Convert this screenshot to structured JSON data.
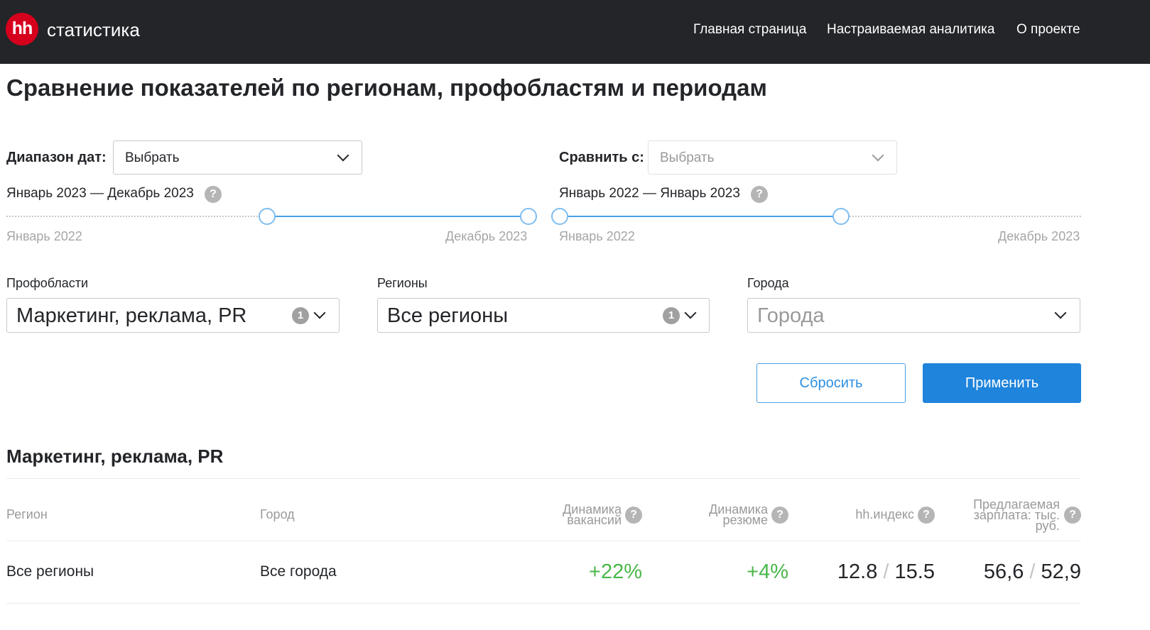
{
  "header": {
    "logo_mark": "hh",
    "logo_text": "статистика",
    "nav": [
      "Главная страница",
      "Настраиваемая аналитика",
      "О проекте"
    ]
  },
  "page_title": "Сравнение показателей по регионам, профобластям и периодам",
  "date_range": {
    "label": "Диапазон дат:",
    "select_value": "Выбрать",
    "range_text": "Январь 2023 — Декабрь 2023",
    "help": "?",
    "slider_min_label": "Январь 2022",
    "slider_max_label": "Декабрь 2023",
    "selected_from": "Январь 2023",
    "selected_to": "Декабрь 2023"
  },
  "compare": {
    "label": "Сравнить с:",
    "select_value": "Выбрать",
    "range_text": "Январь 2022 — Январь 2023",
    "help": "?",
    "slider_min_label": "Январь 2022",
    "slider_max_label": "Декабрь 2023",
    "selected_from": "Январь 2022",
    "selected_to": "Январь 2023"
  },
  "filters": {
    "profareas": {
      "label": "Профобласти",
      "value": "Маркетинг, реклама, PR",
      "count": "1"
    },
    "regions": {
      "label": "Регионы",
      "value": "Все регионы",
      "count": "1"
    },
    "cities": {
      "label": "Города",
      "placeholder": "Города"
    }
  },
  "buttons": {
    "reset": "Сбросить",
    "apply": "Применить"
  },
  "results": {
    "title": "Маркетинг, реклама, PR",
    "columns": {
      "region": "Регион",
      "city": "Город",
      "vacancy_dynamics": [
        "Динамика",
        "вакансий"
      ],
      "resume_dynamics": [
        "Динамика",
        "резюме"
      ],
      "hh_index": "hh.индекс",
      "salary": [
        "Предлагаемая",
        "зарплата: тыс.",
        "руб."
      ]
    },
    "row": {
      "region": "Все регионы",
      "city": "Все города",
      "vacancy_dynamics": "+22%",
      "resume_dynamics": "+4%",
      "hh_index_current": "12.8",
      "hh_index_compare": "15.5",
      "salary_current": "56,6",
      "salary_compare": "52,9",
      "divider": "/"
    }
  },
  "colors": {
    "header_bg": "#232529",
    "logo_red": "#d6001c",
    "accent_blue": "#1f84dc",
    "positive_green": "#49b649"
  }
}
